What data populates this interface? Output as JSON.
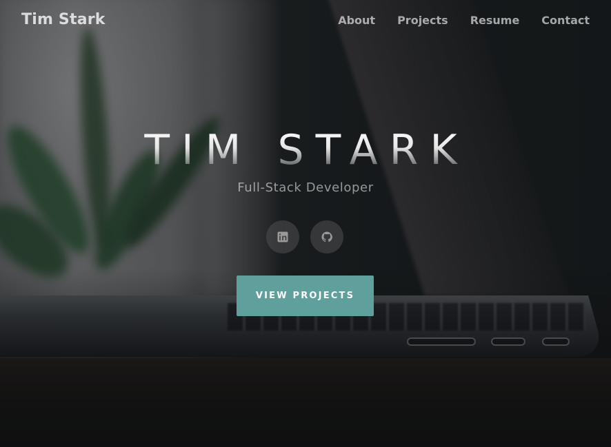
{
  "nav": {
    "brand": "Tim Stark",
    "links": [
      {
        "label": "About"
      },
      {
        "label": "Projects"
      },
      {
        "label": "Resume"
      },
      {
        "label": "Contact"
      }
    ]
  },
  "hero": {
    "title": "TIM STARK",
    "subtitle": "Full-Stack Developer",
    "cta_label": "VIEW PROJECTS",
    "socials": [
      {
        "icon": "linkedin-icon"
      },
      {
        "icon": "github-icon"
      }
    ]
  },
  "colors": {
    "accent": "#5fa09d",
    "background": "#151617",
    "social_bg": "#505050"
  }
}
